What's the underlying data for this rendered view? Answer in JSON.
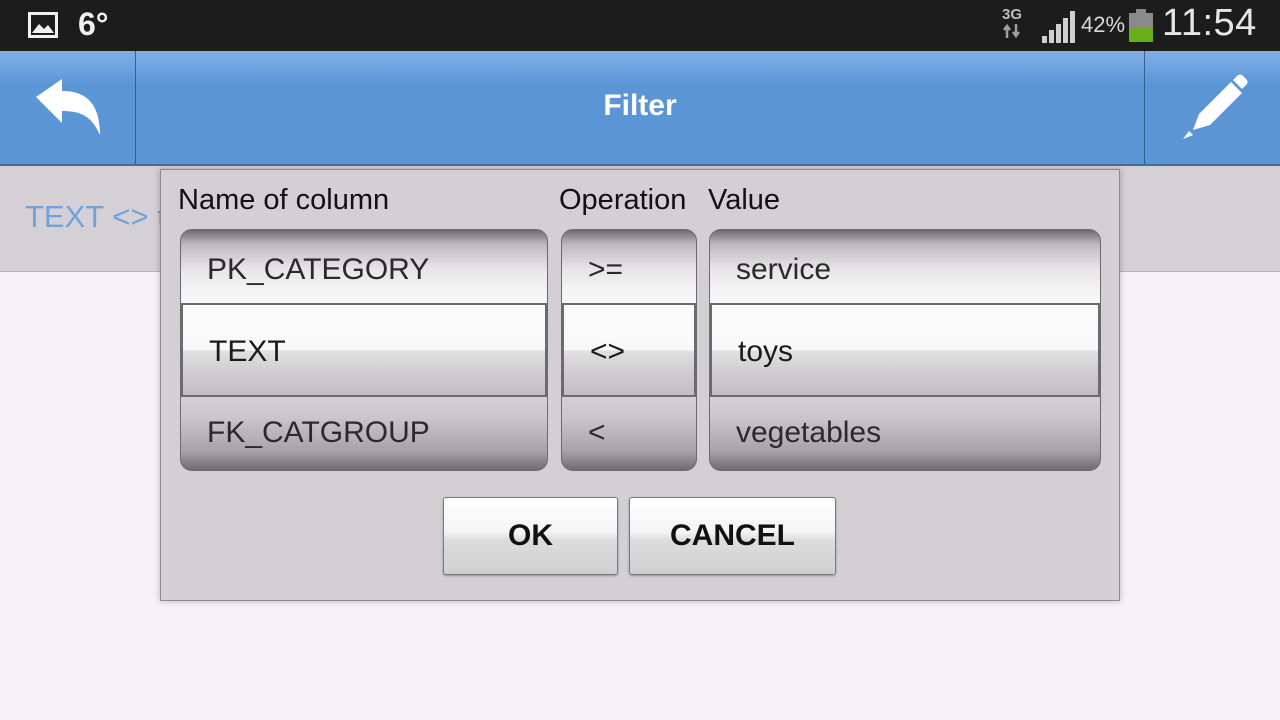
{
  "status_bar": {
    "temperature": "6°",
    "network": "3G",
    "battery_percent": "42%",
    "battery_level": 0.42,
    "time": "11:54",
    "icons": [
      "gallery-icon",
      "data-arrows-icon",
      "signal-icon",
      "battery-icon"
    ]
  },
  "action_bar": {
    "title": "Filter",
    "back_icon": "undo-arrow-icon",
    "edit_icon": "pencil-icon",
    "color": "#5b95d6"
  },
  "background": {
    "filter_text": "TEXT <> t"
  },
  "dialog": {
    "headers": {
      "column": "Name of column",
      "operation": "Operation",
      "value": "Value"
    },
    "columns_picker": [
      "PK_CATEGORY",
      "TEXT",
      "FK_CATGROUP"
    ],
    "operation_picker": [
      ">=",
      "<>",
      "<"
    ],
    "value_picker": [
      "service",
      "toys",
      "vegetables"
    ],
    "selected": {
      "column": "TEXT",
      "operation": "<>",
      "value": "toys"
    },
    "ok_label": "OK",
    "cancel_label": "CANCEL"
  }
}
